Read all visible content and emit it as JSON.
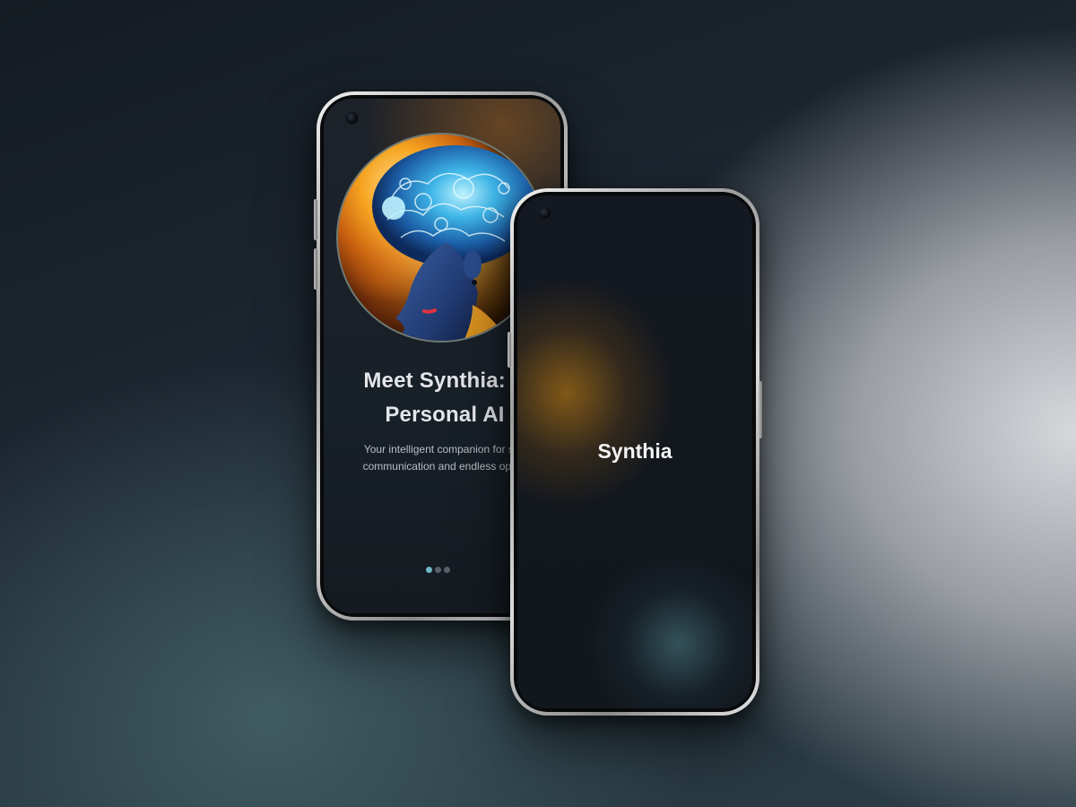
{
  "back_screen": {
    "title": "Meet Synthia: Y\nPersonal AI",
    "subtitle": "Your intelligent companion for sea\ncommunication and endless oppor",
    "pager": {
      "total": 3,
      "active": 1
    },
    "hero_icon": "ai-brain-portrait-icon"
  },
  "front_screen": {
    "title": "Synthia"
  },
  "colors": {
    "accent_teal": "#6fb8c6",
    "accent_orange": "#c48014",
    "screen_dark": "#12171d"
  }
}
